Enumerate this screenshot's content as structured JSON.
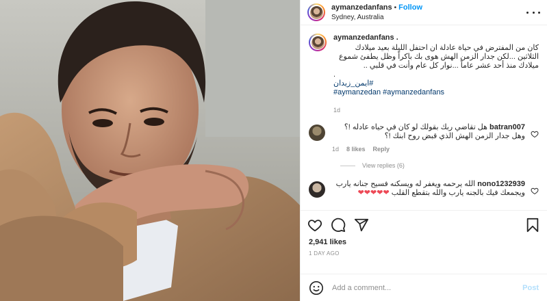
{
  "header": {
    "username": "aymanzedanfans",
    "dot": "•",
    "follow_label": "Follow",
    "location": "Sydney, Australia",
    "more_icon": "more-horizontal-icon"
  },
  "caption": {
    "username": "aymanzedanfans .",
    "text": "كان من المفترض في حياة عادلة ان احتفل الليلة بعيد ميلادك الثلاثين ...لكن جدار الزمن الهش هوى بك باكراً وظل يطفئ شموع ميلادك منذ أحد عشر عاماً ...نوار كل عام وأنت في قلبي ..",
    "dot_line": ".",
    "arabic_tag": "#ايمن_زيدان",
    "tags": "#aymanzedan #aymanzedanfans",
    "time": "1d"
  },
  "comments": [
    {
      "username": "batran007",
      "text": "هل تقاضي ربك بقولك لو كان في حياه عادله !؟ وهل جدار الزمن الهش الذي قبض روح ابنك !؟",
      "time": "1d",
      "likes": "8 likes",
      "reply": "Reply",
      "view_replies": "View replies (6)"
    },
    {
      "username": "nono1232939",
      "text": "الله يرحمه ويغفر له ويسكنه فسيح جنانه يارب ويجمعك فيك بالجنه يارب والله بتقطع القلب",
      "hearts": "❤❤❤❤❤"
    }
  ],
  "actions": {
    "like_icon": "heart-icon",
    "comment_icon": "comment-icon",
    "share_icon": "paper-plane-icon",
    "save_icon": "bookmark-icon"
  },
  "likes": "2,941 likes",
  "date": "1 DAY AGO",
  "add_comment": {
    "placeholder": "Add a comment...",
    "post_label": "Post",
    "emoji_icon": "smiley-icon"
  },
  "colors": {
    "follow": "#0095f6",
    "hashtag": "#00376b",
    "muted": "#8e8e8e",
    "heart": "#ed4956",
    "post_disabled": "#b2dffc"
  }
}
